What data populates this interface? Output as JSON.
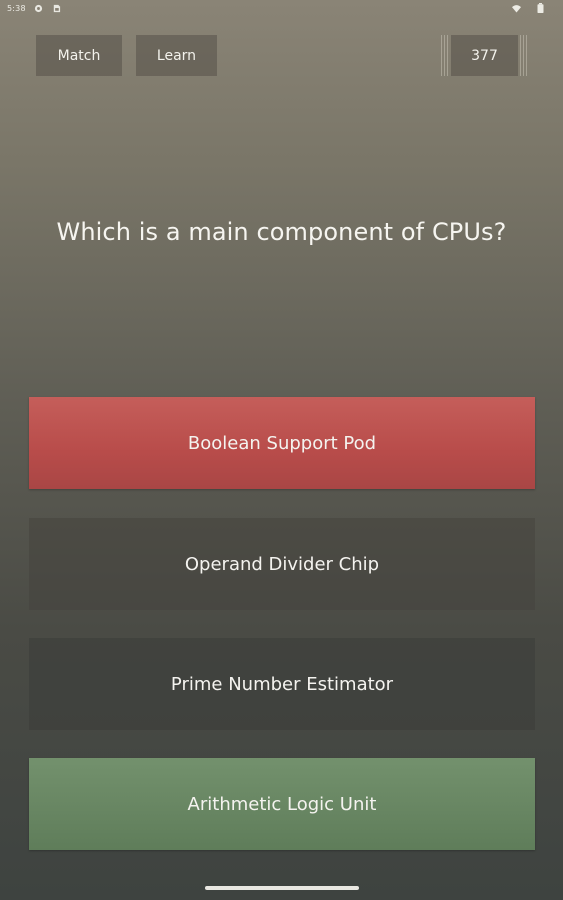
{
  "status_bar": {
    "time": "5:38",
    "icons": [
      "gear-icon",
      "sim-icon",
      "wifi-icon",
      "battery-icon"
    ]
  },
  "top_bar": {
    "match_label": "Match",
    "learn_label": "Learn",
    "score": "377"
  },
  "question": {
    "text": "Which is a main component of CPUs?"
  },
  "answers": [
    {
      "label": "Boolean Support Pod",
      "state": "incorrect",
      "color": "#b84c4a"
    },
    {
      "label": "Operand Divider Chip",
      "state": "neutral",
      "color": "#4b4a44"
    },
    {
      "label": "Prime Number Estimator",
      "state": "neutral",
      "color": "#3f423e"
    },
    {
      "label": "Arithmetic Logic Unit",
      "state": "correct",
      "color": "#66845f"
    }
  ]
}
